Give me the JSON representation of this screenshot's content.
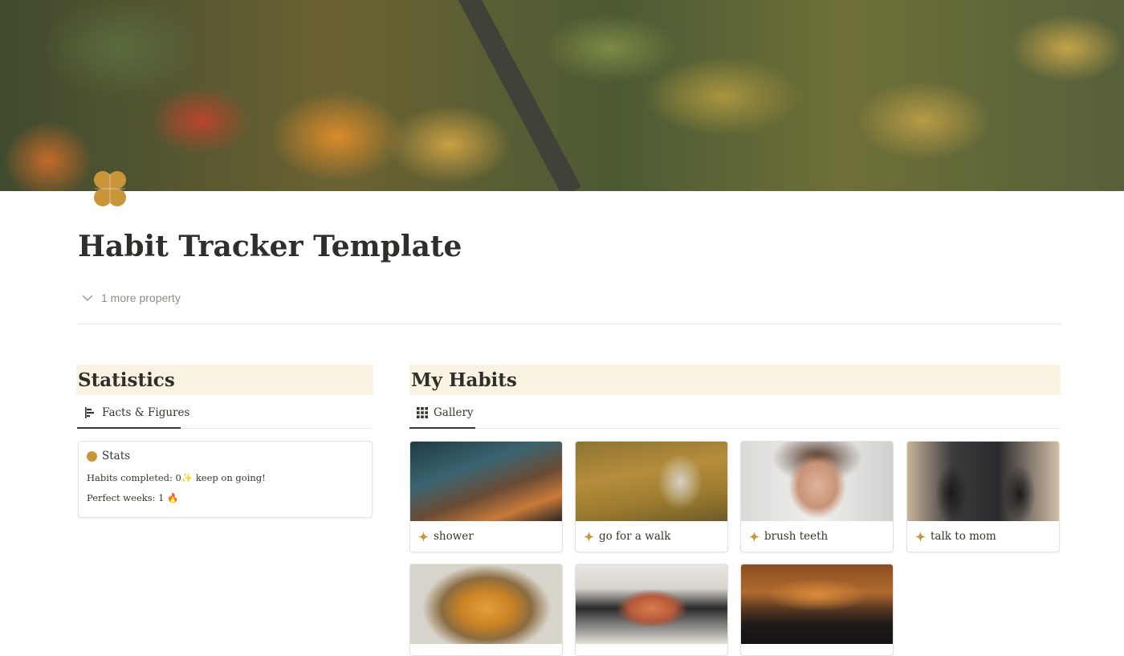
{
  "page": {
    "title": "Habit Tracker Template",
    "property_toggle": "1 more property",
    "icon": "clover-icon",
    "cover": "autumn-forest-aerial-image"
  },
  "statistics": {
    "heading": "Statistics",
    "view_tab": "Facts & Figures",
    "view_icon": "chart-bars-icon",
    "card": {
      "title": "Stats",
      "lines": [
        "Habits completed: 0✨ keep on going!",
        "Perfect weeks: 1 🔥"
      ]
    }
  },
  "habits": {
    "heading": "My Habits",
    "view_tab": "Gallery",
    "view_icon": "gallery-grid-icon",
    "cards": [
      {
        "label": "shower",
        "image": "candlelit-bath-image"
      },
      {
        "label": "go for a walk",
        "image": "autumn-bench-image"
      },
      {
        "label": "brush teeth",
        "image": "brushing-teeth-image"
      },
      {
        "label": "talk to mom",
        "image": "two-people-talking-image"
      },
      {
        "label": "",
        "image": "pasta-dish-image"
      },
      {
        "label": "",
        "image": "handheld-game-console-image"
      },
      {
        "label": "",
        "image": "autumn-road-driving-image"
      }
    ]
  },
  "colors": {
    "heading_bg": "#fbf3e1",
    "accent": "#c9953a",
    "text": "#37352f"
  }
}
